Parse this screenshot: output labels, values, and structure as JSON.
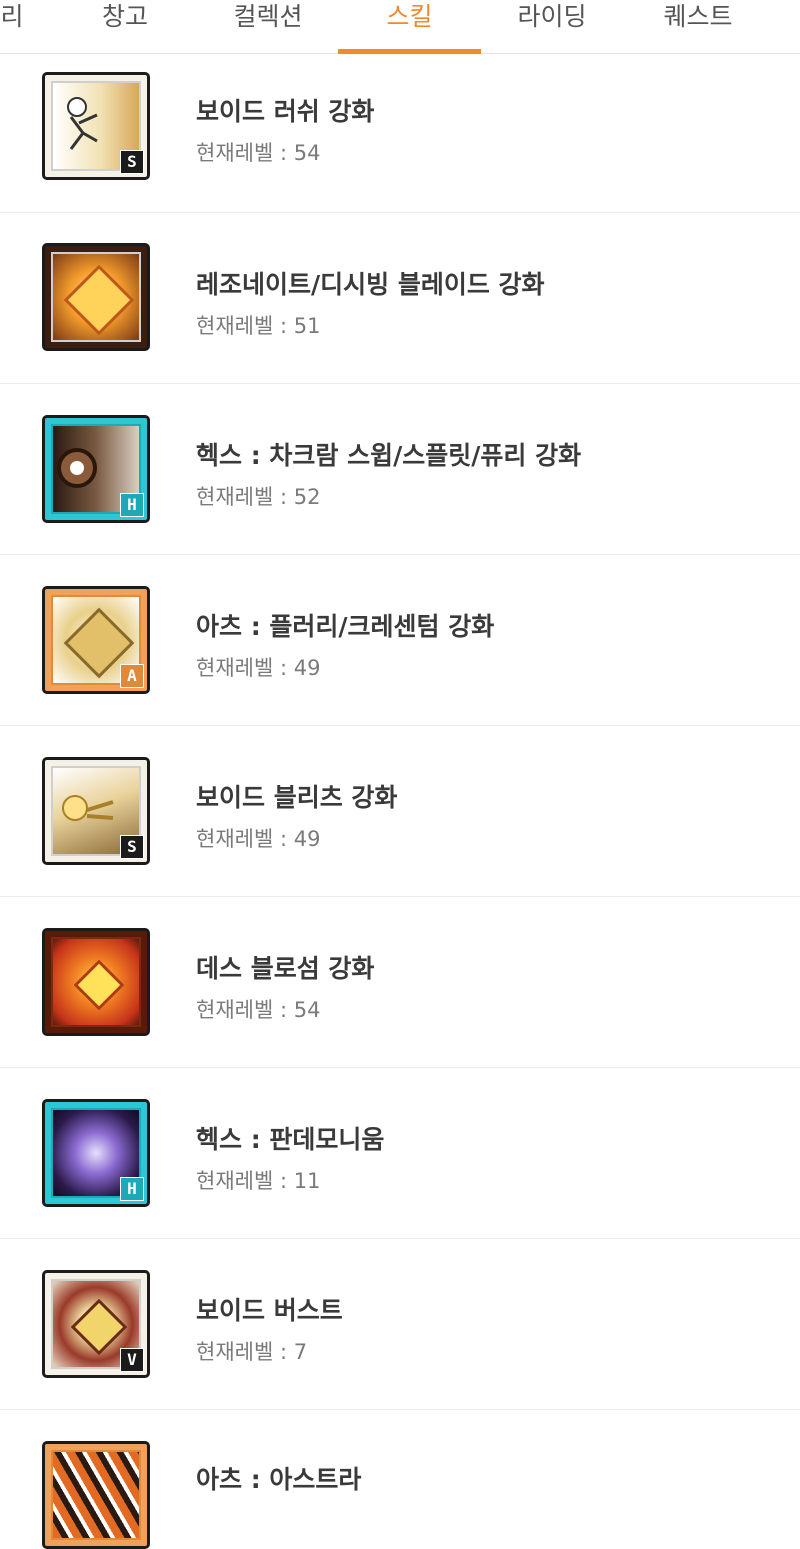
{
  "tabs": [
    {
      "label": "리",
      "active": false
    },
    {
      "label": "창고",
      "active": false
    },
    {
      "label": "컬렉션",
      "active": false
    },
    {
      "label": "스킬",
      "active": true
    },
    {
      "label": "라이딩",
      "active": false
    },
    {
      "label": "퀘스트",
      "active": false
    }
  ],
  "colors": {
    "accent": "#f08a2c"
  },
  "skills": [
    {
      "name": "보이드 러쉬 강화",
      "level": "현재레벨 : 54",
      "badge": "S",
      "icon": "void-rush-icon"
    },
    {
      "name": "레조네이트/디시빙 블레이드 강화",
      "level": "현재레벨 : 51",
      "badge": "",
      "icon": "resonate-blade-icon"
    },
    {
      "name": "헥스 : 차크람 스윕/스플릿/퓨리 강화",
      "level": "현재레벨 : 52",
      "badge": "H",
      "icon": "hex-chakram-icon"
    },
    {
      "name": "아츠 : 플러리/크레센텀 강화",
      "level": "현재레벨 : 49",
      "badge": "A",
      "icon": "arts-flurry-icon"
    },
    {
      "name": "보이드 블리츠 강화",
      "level": "현재레벨 : 49",
      "badge": "S",
      "icon": "void-blitz-icon"
    },
    {
      "name": "데스 블로섬 강화",
      "level": "현재레벨 : 54",
      "badge": "",
      "icon": "death-blossom-icon"
    },
    {
      "name": "헥스 : 판데모니움",
      "level": "현재레벨 : 11",
      "badge": "H",
      "icon": "hex-pandemonium-icon"
    },
    {
      "name": "보이드 버스트",
      "level": "현재레벨 : 7",
      "badge": "V",
      "icon": "void-burst-icon"
    },
    {
      "name": "아츠 : 아스트라",
      "level": "",
      "badge": "",
      "icon": "arts-astra-icon"
    }
  ]
}
